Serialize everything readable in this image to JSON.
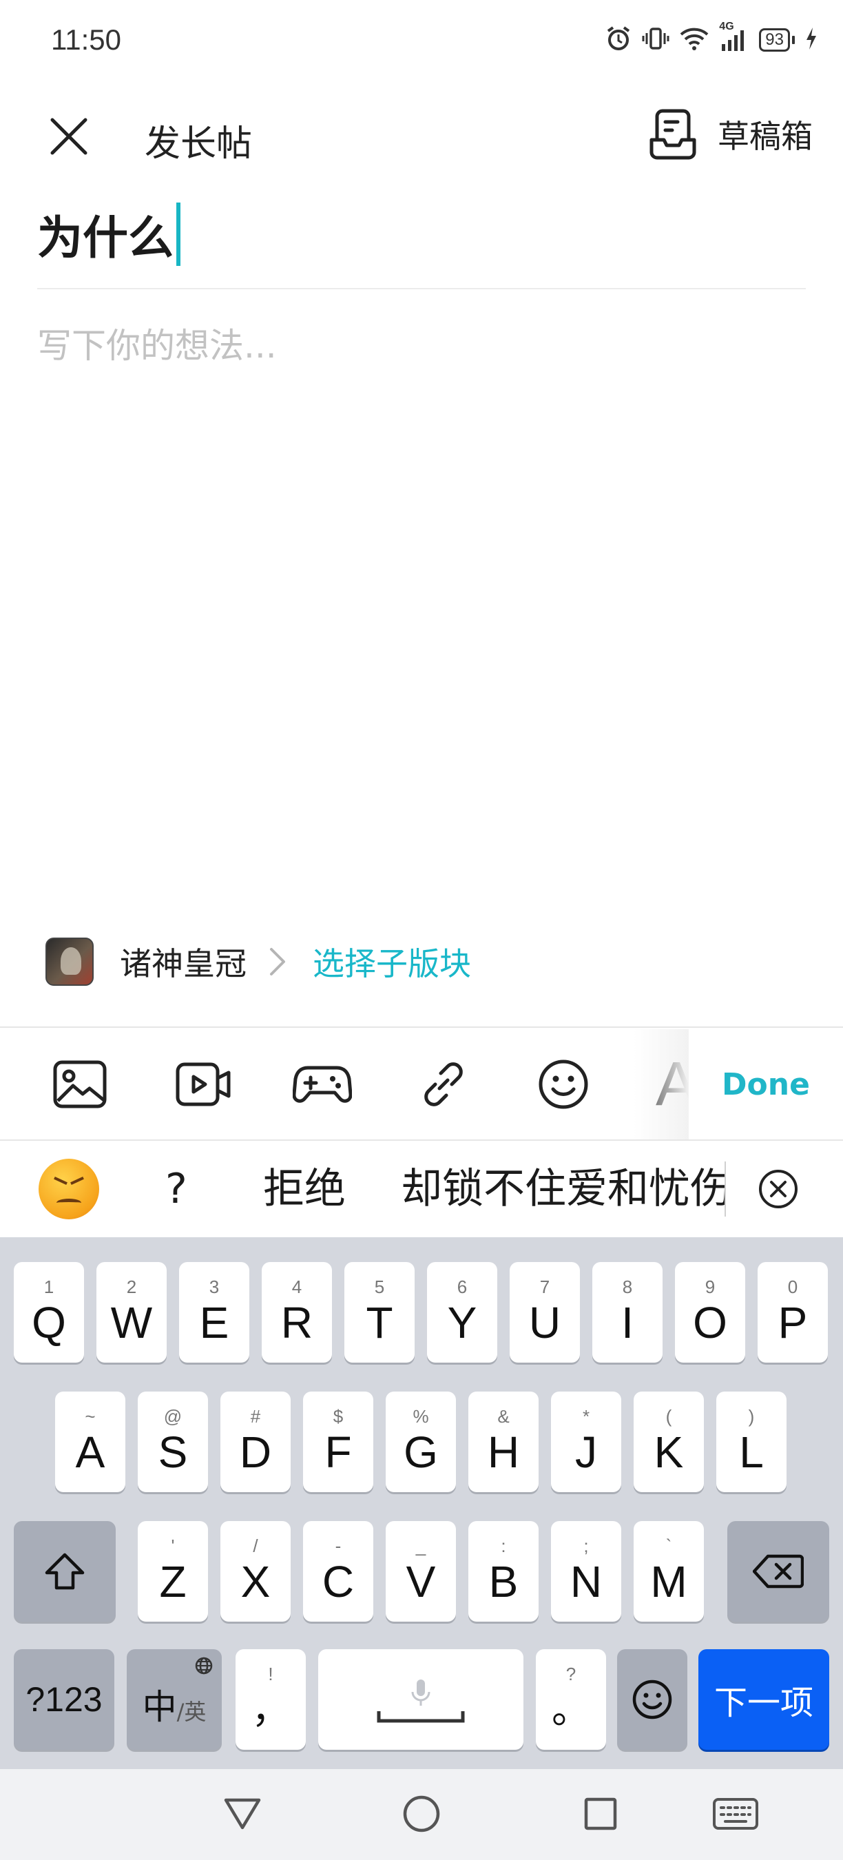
{
  "status_bar": {
    "time": "11:50",
    "network": "4G",
    "battery": "93"
  },
  "header": {
    "title": "发长帖",
    "draft_label": "草稿箱"
  },
  "editor": {
    "title_value": "为什么",
    "body_placeholder": "写下你的想法..."
  },
  "forum": {
    "name": "诸神皇冠",
    "subforum_link": "选择子版块"
  },
  "toolbar": {
    "tools": [
      "image-icon",
      "video-icon",
      "gamepad-icon",
      "link-icon",
      "emoji-icon",
      "text-format-icon"
    ],
    "text_tool_glyph": "A",
    "done_label": "Done"
  },
  "suggestions": {
    "items": [
      "?",
      "拒绝",
      "却锁不住爱和忧伤"
    ]
  },
  "keyboard": {
    "row1": [
      {
        "hint": "1",
        "key": "Q"
      },
      {
        "hint": "2",
        "key": "W"
      },
      {
        "hint": "3",
        "key": "E"
      },
      {
        "hint": "4",
        "key": "R"
      },
      {
        "hint": "5",
        "key": "T"
      },
      {
        "hint": "6",
        "key": "Y"
      },
      {
        "hint": "7",
        "key": "U"
      },
      {
        "hint": "8",
        "key": "I"
      },
      {
        "hint": "9",
        "key": "O"
      },
      {
        "hint": "0",
        "key": "P"
      }
    ],
    "row2": [
      {
        "hint": "~",
        "key": "A"
      },
      {
        "hint": "@",
        "key": "S"
      },
      {
        "hint": "#",
        "key": "D"
      },
      {
        "hint": "$",
        "key": "F"
      },
      {
        "hint": "%",
        "key": "G"
      },
      {
        "hint": "&",
        "key": "H"
      },
      {
        "hint": "*",
        "key": "J"
      },
      {
        "hint": "(",
        "key": "K"
      },
      {
        "hint": ")",
        "key": "L"
      }
    ],
    "row3": [
      {
        "hint": "'",
        "key": "Z"
      },
      {
        "hint": "/",
        "key": "X"
      },
      {
        "hint": "-",
        "key": "C"
      },
      {
        "hint": "_",
        "key": "V"
      },
      {
        "hint": ":",
        "key": "B"
      },
      {
        "hint": ";",
        "key": "N"
      },
      {
        "hint": "`",
        "key": "M"
      }
    ],
    "symbols_label": "?123",
    "lang_main": "中",
    "lang_alt": "/英",
    "comma_hint": "!",
    "comma_key": "，",
    "period_hint": "?",
    "period_key": "。",
    "action_label": "下一项"
  },
  "colors": {
    "accent": "#19b7c9",
    "action_key": "#0a60f5",
    "keyboard_bg": "#d4d7de"
  }
}
